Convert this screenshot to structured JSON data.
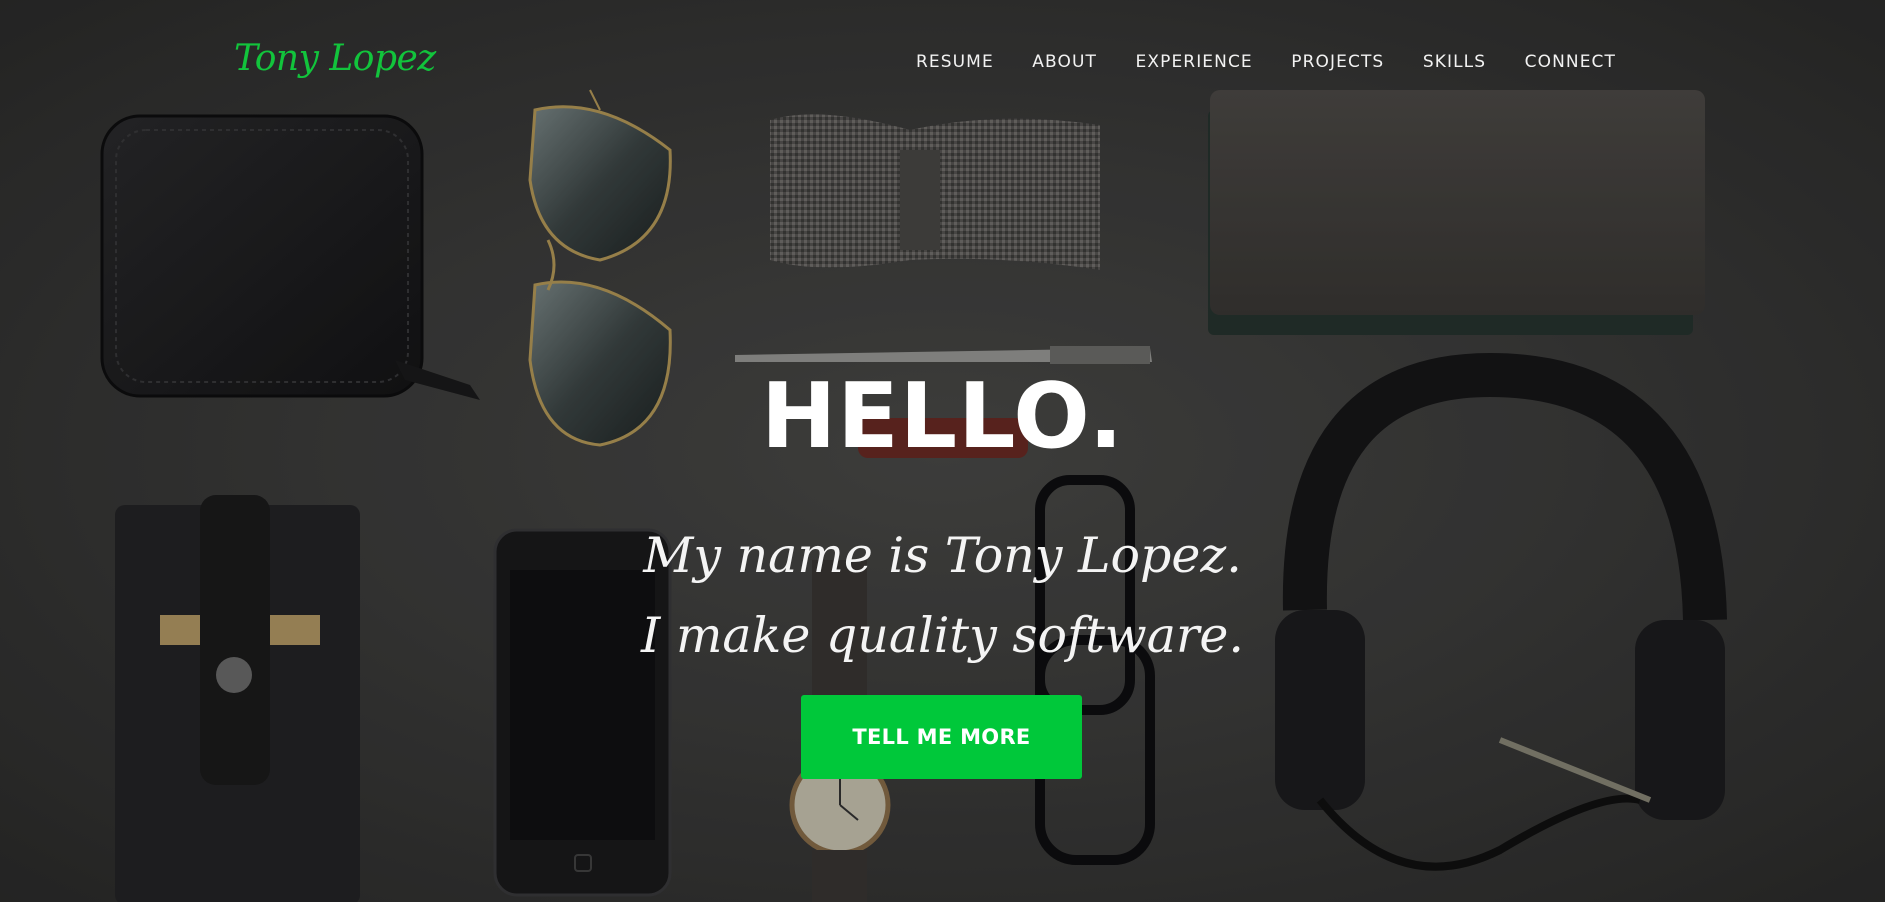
{
  "brand": {
    "name": "Tony Lopez",
    "color": "#12c43c"
  },
  "nav": {
    "items": [
      {
        "label": "RESUME"
      },
      {
        "label": "ABOUT"
      },
      {
        "label": "EXPERIENCE"
      },
      {
        "label": "PROJECTS"
      },
      {
        "label": "SKILLS"
      },
      {
        "label": "CONNECT"
      }
    ]
  },
  "hero": {
    "headline": "HELLO.",
    "subline_1": "My name is Tony Lopez.",
    "subline_2": "I make quality software.",
    "cta_label": "TELL ME MORE",
    "cta_color": "#00c83a",
    "background": "flat-lay photo: wallet, aviator sunglasses, bow tie, notebook, pen, card holder, smartphone, wristwatch, eyeglasses, headphones on dark surface"
  }
}
